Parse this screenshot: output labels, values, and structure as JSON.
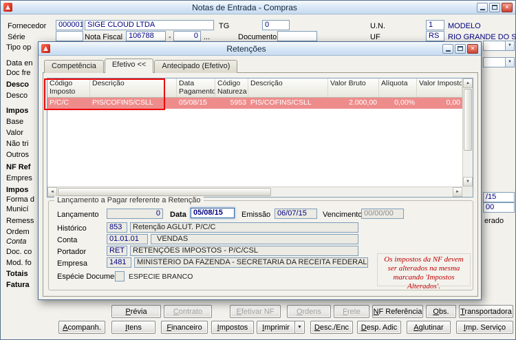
{
  "icons": {
    "close": "✕",
    "dropdown": "▼",
    "up_arrow": "▲",
    "down_arrow": "▼",
    "left_arrow": "◄",
    "right_arrow": "►",
    "ellipsis": "..."
  },
  "main_window": {
    "title": "Notas de Entrada - Compras",
    "header": {
      "fornecedor_label": "Fornecedor",
      "fornecedor_code": "000001",
      "fornecedor_name": "SIGE CLOUD LTDA",
      "tg_label": "TG",
      "tg_value": "0",
      "un_label": "U.N.",
      "un_value": "1",
      "un_desc": "MODELO",
      "serie_label": "Série",
      "serie_value": "",
      "nota_fiscal_label": "Nota Fiscal",
      "nota_fiscal_number": "106788",
      "nota_fiscal_dash": "-",
      "nota_fiscal_sub": "0",
      "documento_label": "Documento",
      "documento_value": "",
      "uf_label": "UF",
      "uf_value": "RS",
      "uf_desc": "RIO GRANDE DO SUL"
    },
    "left_labels": [
      "Tipo op",
      "Data en",
      "Doc fre",
      "Desco",
      "Desco",
      "Impos",
      "Base",
      "Valor",
      "Não tri",
      "Outros",
      "NF Ref",
      "Empres",
      "Impos",
      "Forma d",
      "Municí",
      "Remess",
      "Ordem",
      "Conta",
      "Doc. co",
      "Mod. fo",
      "Totais",
      "Fatura"
    ],
    "right_fragments": [
      "/15",
      "00",
      "erado"
    ],
    "buttons_row1": [
      "Prévia",
      "Contrato",
      "Efetivar NF",
      "Ordens",
      "Frete",
      "NF Referência",
      "Obs.",
      "Transportadora"
    ],
    "buttons_row2": [
      "Acompanh.",
      "Itens",
      "Financeiro",
      "Impostos",
      "Imprimir",
      "Desc./Enc",
      "Desp. Adic",
      "Aglutinar",
      "Imp. Serviço"
    ]
  },
  "dialog": {
    "title": "Retenções",
    "tabs": [
      "Competência",
      "Efetivo <<",
      "Antecipado (Efetivo)"
    ],
    "grid": {
      "columns": [
        "Código Imposto",
        "Descrição",
        "Data Pagamento",
        "Código Natureza",
        "Descrição",
        "Valor Bruto",
        "Alíquota",
        "Valor Imposto"
      ],
      "row": [
        "P/C/C",
        "PIS/COFINS/CSLL",
        "05/08/15",
        "5953",
        "PIS/COFINS/CSLL",
        "2.000,00",
        "0,00%",
        "0,00"
      ]
    },
    "lancamento": {
      "group_title": "Lançamento a Pagar referente a Retenção",
      "lancamento_label": "Lançamento",
      "lancamento_value": "0",
      "data_label": "Data",
      "data_value": "05/08/15",
      "emissao_label": "Emissão",
      "emissao_value": "06/07/15",
      "vencimento_label": "Vencimento",
      "vencimento_value": "00/00/00",
      "historico_label": "Histórico",
      "historico_code": "853",
      "historico_desc": "Retenção AGLUT. P/C/C",
      "conta_label": "Conta",
      "conta_code": "01.01.01",
      "conta_desc": "VENDAS",
      "portador_label": "Portador",
      "portador_code": "RET",
      "portador_desc": "RETENÇÕES IMPOSTOS - P/C/CSL",
      "empresa_label": "Empresa",
      "empresa_code": "1481",
      "empresa_desc": "MINISTÉRIO DA FAZENDA - SECRETARIA DA RECEITA FEDERAL",
      "especie_label": "Espécie Documento",
      "especie_value": "ESPECIE BRANCO"
    },
    "warning": "Os impostos da NF devem ser alterados na mesma marcando 'Impostos Alterados'."
  },
  "colors": {
    "value_text": "#000080",
    "selected_row_bg": "#ee8c8c",
    "annotation_red": "#ec0000",
    "warning_red": "#c00000"
  }
}
